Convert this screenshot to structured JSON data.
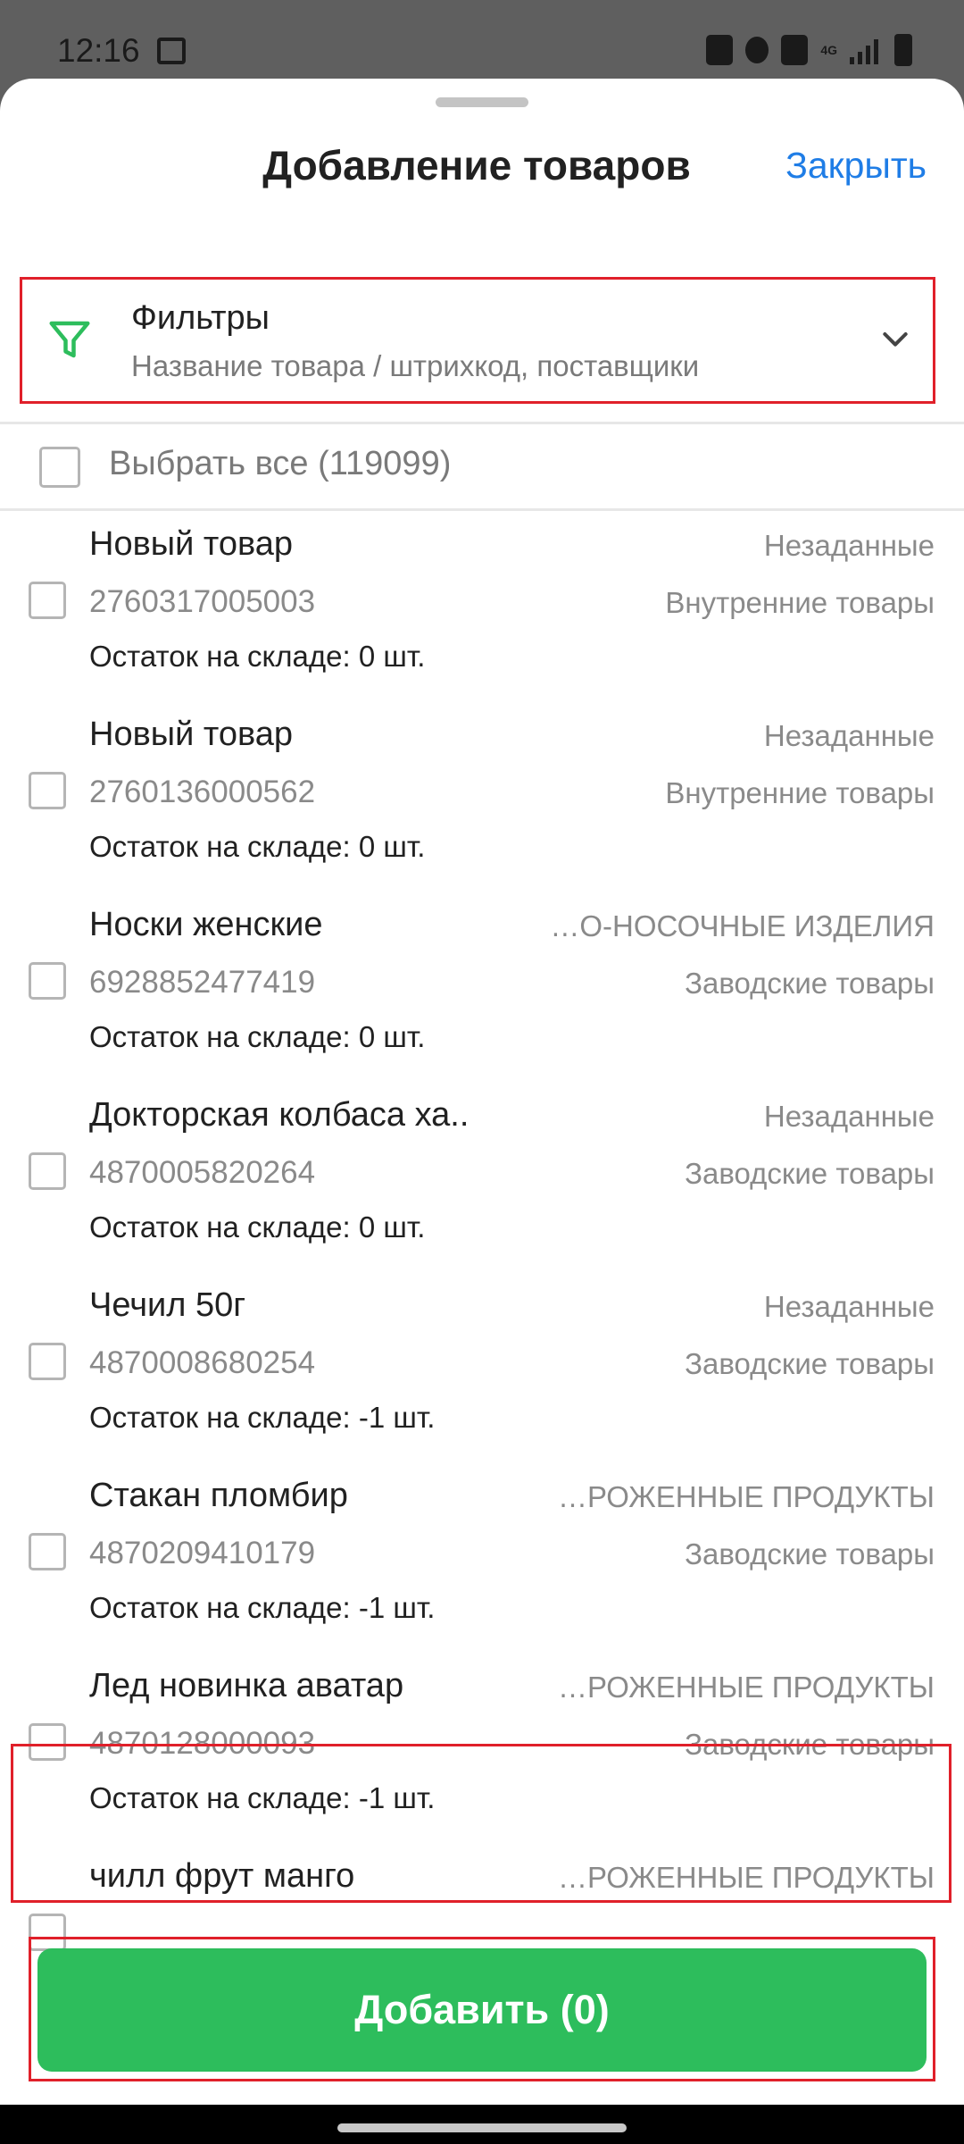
{
  "status_bar": {
    "time": "12:16",
    "network": "4G",
    "icons": [
      "image-icon",
      "battery-saver-icon",
      "alarm-icon",
      "mute-icon",
      "signal-icon",
      "battery-icon"
    ]
  },
  "header": {
    "title": "Добавление товаров",
    "close_label": "Закрыть"
  },
  "filters": {
    "title": "Фильтры",
    "subtitle": "Название товара / штрихкод, поставщики",
    "icon": "filter-icon",
    "accent": "#2dbd5c"
  },
  "select_all": {
    "label": "Выбрать все (119099)"
  },
  "products": [
    {
      "name": "Новый товар",
      "category": "Незаданные",
      "barcode": "2760317005003",
      "group": "Внутренние товары",
      "stock": "Остаток на складе: 0 шт."
    },
    {
      "name": "Новый товар",
      "category": "Незаданные",
      "barcode": "2760136000562",
      "group": "Внутренние товары",
      "stock": "Остаток на складе: 0 шт."
    },
    {
      "name": "Носки женские",
      "category": "…О-НОСОЧНЫЕ ИЗДЕЛИЯ",
      "barcode": "6928852477419",
      "group": "Заводские товары",
      "stock": "Остаток на складе: 0 шт."
    },
    {
      "name": "Докторская колбаса ха..",
      "category": "Незаданные",
      "barcode": "4870005820264",
      "group": "Заводские товары",
      "stock": "Остаток на складе: 0 шт."
    },
    {
      "name": "Чечил 50г",
      "category": "Незаданные",
      "barcode": "4870008680254",
      "group": "Заводские товары",
      "stock": "Остаток на складе: -1 шт."
    },
    {
      "name": "Стакан пломбир",
      "category": "…РОЖЕННЫЕ ПРОДУКТЫ",
      "barcode": "4870209410179",
      "group": "Заводские товары",
      "stock": "Остаток на складе: -1 шт."
    },
    {
      "name": "Лед новинка аватар",
      "category": "…РОЖЕННЫЕ ПРОДУКТЫ",
      "barcode": "4870128000093",
      "group": "Заводские товары",
      "stock": "Остаток на складе: -1 шт."
    },
    {
      "name": "чилл фрут манго",
      "category": "…РОЖЕННЫЕ ПРОДУКТЫ",
      "barcode": "",
      "group": "",
      "stock": ""
    }
  ],
  "add_button": {
    "label": "Добавить (0)",
    "color": "#2dbd5c"
  },
  "highlight_color": "#e0202a"
}
